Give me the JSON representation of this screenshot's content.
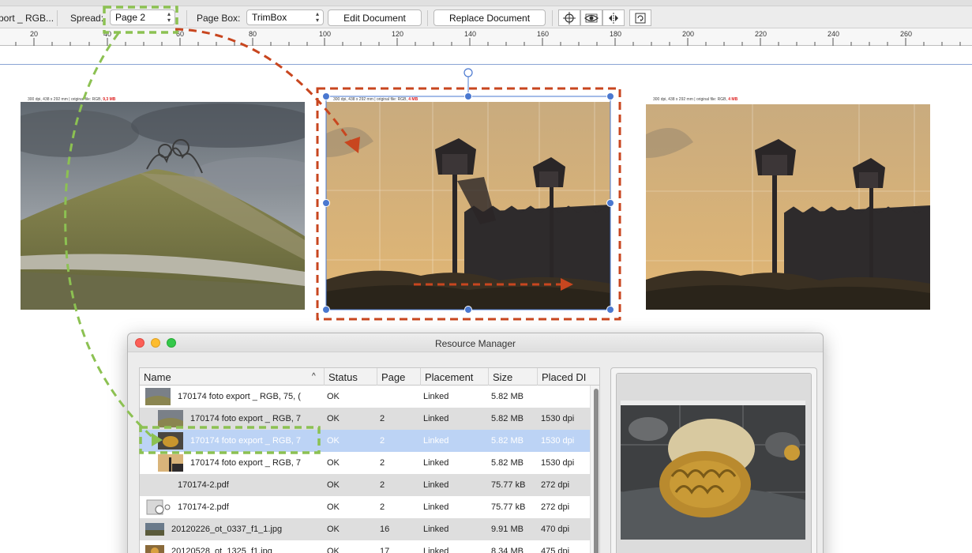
{
  "toolbar": {
    "doc_name": "port _ RGB...",
    "spread_label": "Spread:",
    "spread_value": "Page 2",
    "page_box_label": "Page Box:",
    "page_box_value": "TrimBox",
    "edit_document_label": "Edit Document",
    "replace_document_label": "Replace Document",
    "icons": [
      "crosshair-icon",
      "eye-icon",
      "flip-icon",
      "rotate-icon"
    ]
  },
  "ruler": {
    "ticks": [
      "20",
      "40",
      "60",
      "80",
      "100",
      "120",
      "140",
      "160",
      "180",
      "200",
      "220",
      "240",
      "260"
    ]
  },
  "canvas": {
    "captions": [
      {
        "text": "300 dpi, 438 x 292 mm | original file: RGB, ",
        "size": "9,3 MB"
      },
      {
        "text": "300 dpi, 438 x 292 mm | original file: RGB, ",
        "size": "4 MB"
      },
      {
        "text": "300 dpi, 438 x 292 mm | original file: RGB, ",
        "size": "4 MB"
      }
    ]
  },
  "resource_manager": {
    "title": "Resource Manager",
    "columns": [
      "Name",
      "Status",
      "Page",
      "Placement",
      "Size",
      "Placed DI"
    ],
    "rows": [
      {
        "name": "170174 foto export _ RGB, 75, (",
        "status": "OK",
        "page": "",
        "placement": "Linked",
        "size": "5.82 MB",
        "dpi": ""
      },
      {
        "name": "170174 foto export _ RGB, 7",
        "status": "OK",
        "page": "2",
        "placement": "Linked",
        "size": "5.82 MB",
        "dpi": "1530 dpi"
      },
      {
        "name": "170174 foto export _ RGB, 7",
        "status": "OK",
        "page": "2",
        "placement": "Linked",
        "size": "5.82 MB",
        "dpi": "1530 dpi"
      },
      {
        "name": "170174 foto export _ RGB, 7",
        "status": "OK",
        "page": "2",
        "placement": "Linked",
        "size": "5.82 MB",
        "dpi": "1530 dpi"
      },
      {
        "name": "170174-2.pdf",
        "status": "OK",
        "page": "2",
        "placement": "Linked",
        "size": "75.77 kB",
        "dpi": "272 dpi"
      },
      {
        "name": "170174-2.pdf",
        "status": "OK",
        "page": "2",
        "placement": "Linked",
        "size": "75.77 kB",
        "dpi": "272 dpi"
      },
      {
        "name": "20120226_ot_0337_f1_1.jpg",
        "status": "OK",
        "page": "16",
        "placement": "Linked",
        "size": "9.91 MB",
        "dpi": "470 dpi"
      },
      {
        "name": "20120528_ot_1325_f1.jpg",
        "status": "OK",
        "page": "17",
        "placement": "Linked",
        "size": "8.34 MB",
        "dpi": "475 dpi"
      }
    ],
    "selected_row": 2
  },
  "colors": {
    "annotation_red": "#c8461f",
    "annotation_green": "#8cc152",
    "selection_blue": "#4a78d0",
    "row_selected": "#bcd3f5"
  }
}
